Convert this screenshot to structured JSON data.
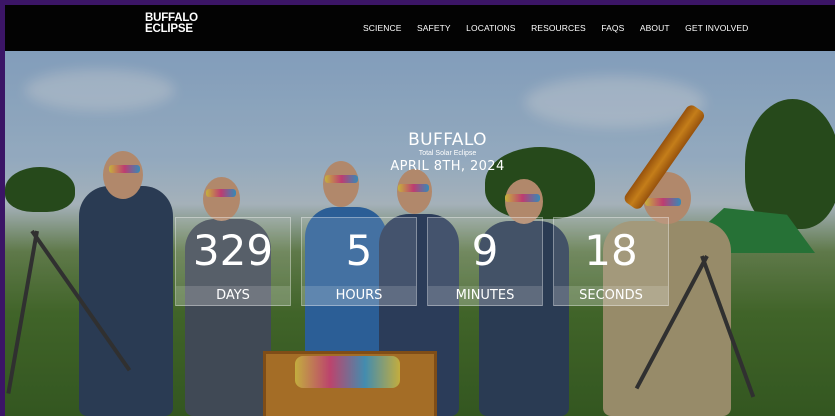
{
  "header": {
    "logo_line1": "BUFFALO",
    "logo_line2": "ECLIPSE",
    "nav": [
      "SCIENCE",
      "SAFETY",
      "LOCATIONS",
      "RESOURCES",
      "FAQS",
      "ABOUT",
      "GET INVOLVED"
    ]
  },
  "hero": {
    "city": "BUFFALO",
    "subtitle": "Total Solar Eclipse",
    "date": "APRIL 8TH, 2024",
    "countdown": [
      {
        "value": "329",
        "label": "DAYS"
      },
      {
        "value": "5",
        "label": "HOURS"
      },
      {
        "value": "9",
        "label": "MINUTES"
      },
      {
        "value": "18",
        "label": "SECONDS"
      }
    ]
  },
  "colors": {
    "outer_frame": "#3b1566",
    "navbar": "#030303",
    "text": "#ffffff",
    "accent_orange": "#f09a20",
    "grass_green": "#4f7a32"
  }
}
